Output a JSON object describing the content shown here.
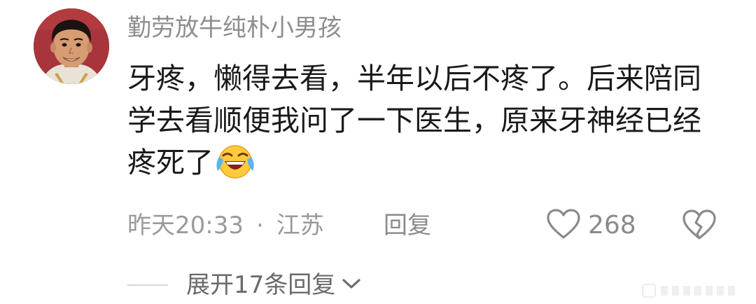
{
  "comment": {
    "username": "勤劳放牛纯朴小男孩",
    "text": "牙疼，懒得去看，半年以后不疼了。后来陪同学去看顺便我问了一下医生，原来牙神经已经疼死了",
    "emoji": "crying-laughing-emoji",
    "time": "昨天20:33",
    "separator": "·",
    "location": "江苏",
    "reply_label": "回复",
    "like_count": "268",
    "expand_replies_label": "展开17条回复"
  },
  "icons": {
    "like": "heart-outline-icon",
    "dislike": "broken-heart-icon",
    "expand": "chevron-down-icon"
  },
  "colors": {
    "username": "#8e8e8e",
    "text": "#1a1a1a",
    "meta": "#9a9a9a",
    "avatar_bg": "#a8353c"
  }
}
